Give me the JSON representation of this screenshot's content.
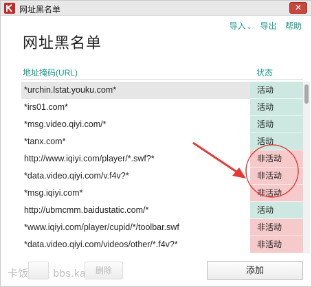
{
  "window": {
    "title": "网址黑名单",
    "close_glyph": "✕"
  },
  "menu": {
    "import_label": "导入",
    "import_chevron": "⌄",
    "export_label": "导出",
    "help_label": "帮助"
  },
  "page_title": "网址黑名单",
  "columns": {
    "url": "地址掩码(URL)",
    "status": "状态"
  },
  "rows": [
    {
      "url": "*urchin.lstat.youku.com*",
      "status": "活动",
      "state": "active"
    },
    {
      "url": "*irs01.com*",
      "status": "活动",
      "state": "active"
    },
    {
      "url": "*msg.video.qiyi.com/*",
      "status": "活动",
      "state": "active"
    },
    {
      "url": "*tanx.com*",
      "status": "活动",
      "state": "active"
    },
    {
      "url": "http://www.iqiyi.com/player/*.swf?*",
      "status": "非活动",
      "state": "inactive"
    },
    {
      "url": "*data.video.qiyi.com/v.f4v?*",
      "status": "非活动",
      "state": "inactive"
    },
    {
      "url": "*msg.iqiyi.com*",
      "status": "非活动",
      "state": "inactive"
    },
    {
      "url": "http://ubmcmm.baidustatic.com/*",
      "status": "活动",
      "state": "active"
    },
    {
      "url": "*www.iqiyi.com/player/cupid/*/toolbar.swf",
      "status": "非活动",
      "state": "inactive"
    },
    {
      "url": "*data.video.qiyi.com/videos/other/*.f4v?*",
      "status": "非活动",
      "state": "inactive"
    }
  ],
  "buttons": {
    "edit_label": "",
    "delete_label": "删除",
    "add_label": "添加"
  },
  "watermark": "卡饭论坛 bbs.kafan.cn",
  "colors": {
    "accent": "#1a9a8a",
    "active_bg": "#cce8e0",
    "inactive_bg": "#f6caca",
    "close_bg": "#c9463d",
    "annotation_red": "#e53935"
  },
  "icons": {
    "app_icon": "kaspersky-k-icon",
    "close": "close-icon"
  }
}
